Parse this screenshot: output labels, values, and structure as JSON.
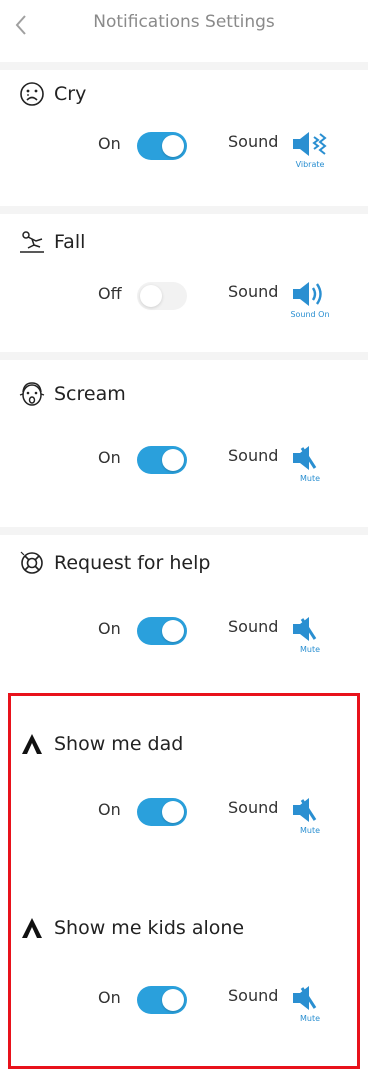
{
  "header": {
    "back_icon": "chevron-left-icon",
    "title": "Notifications Settings"
  },
  "colors": {
    "accent": "#2aa0dc",
    "highlight_border": "#e8121b",
    "separator": "#f4f4f4"
  },
  "sections": [
    {
      "icon": "sad-face-icon",
      "title": "Cry",
      "state": "On",
      "toggle_on": true,
      "sound_label": "Sound",
      "sound_icon": "speaker-vibrate-icon",
      "sound_mode": "Vibrate"
    },
    {
      "icon": "fall-icon",
      "title": "Fall",
      "state": "Off",
      "toggle_on": false,
      "sound_label": "Sound",
      "sound_icon": "speaker-on-icon",
      "sound_mode": "Sound On"
    },
    {
      "icon": "scream-face-icon",
      "title": "Scream",
      "state": "On",
      "toggle_on": true,
      "sound_label": "Sound",
      "sound_icon": "speaker-mute-icon",
      "sound_mode": "Mute"
    },
    {
      "icon": "lifebuoy-icon",
      "title": "Request for help",
      "state": "On",
      "toggle_on": true,
      "sound_label": "Sound",
      "sound_icon": "speaker-mute-icon",
      "sound_mode": "Mute"
    },
    {
      "icon": "logo-a-icon",
      "title": "Show me dad",
      "state": "On",
      "toggle_on": true,
      "sound_label": "Sound",
      "sound_icon": "speaker-mute-icon",
      "sound_mode": "Mute"
    },
    {
      "icon": "logo-a-icon",
      "title": "Show me kids alone",
      "state": "On",
      "toggle_on": true,
      "sound_label": "Sound",
      "sound_icon": "speaker-mute-icon",
      "sound_mode": "Mute"
    }
  ]
}
